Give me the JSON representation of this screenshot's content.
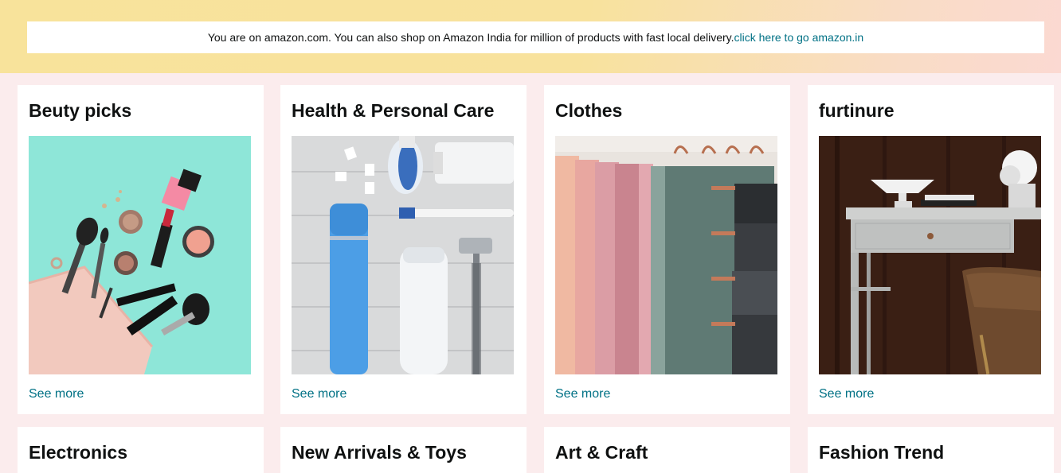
{
  "notice": {
    "text": "You are on amazon.com. You can also shop on Amazon India for million of products with fast local delivery.",
    "link": "click here to go amazon.in"
  },
  "cards": [
    {
      "title": "Beuty picks",
      "link": "See more"
    },
    {
      "title": "Health & Personal Care",
      "link": "See more"
    },
    {
      "title": "Clothes",
      "link": "See more"
    },
    {
      "title": "furtinure",
      "link": "See more"
    },
    {
      "title": "Electronics"
    },
    {
      "title": "New Arrivals & Toys"
    },
    {
      "title": "Art & Craft"
    },
    {
      "title": "Fashion Trend"
    }
  ],
  "colors": {
    "link": "#007185",
    "page_background": "#fbeced",
    "banner_gradient_start": "#f8e39b",
    "banner_gradient_end": "#fbd9d2"
  }
}
